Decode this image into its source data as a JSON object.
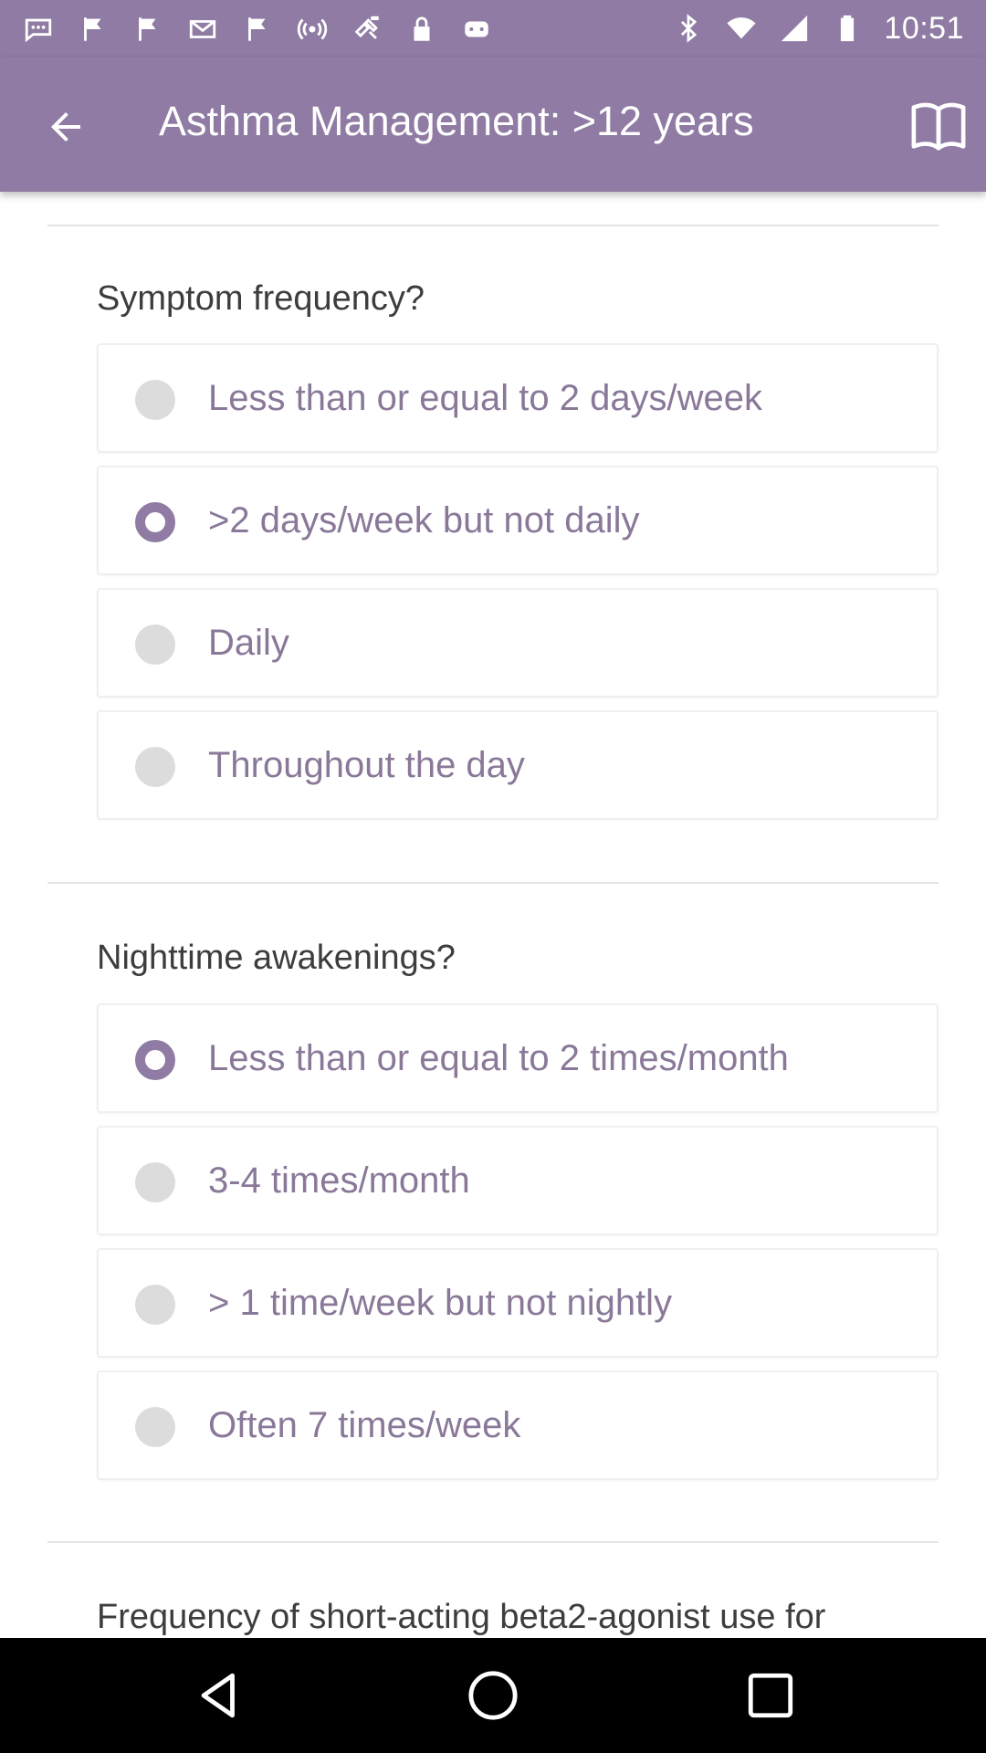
{
  "status_bar": {
    "time": "10:51",
    "left_icons": [
      "message-icon",
      "flag-icon",
      "flag-icon",
      "mail-icon",
      "flag-icon",
      "hotspot-icon",
      "fake-gps-icon",
      "lock-icon",
      "game-controller-icon"
    ],
    "right_icons": [
      "bluetooth-icon",
      "wifi-icon",
      "signal-icon",
      "battery-icon"
    ]
  },
  "app_bar": {
    "title": "Asthma Management: >12 years",
    "back_icon": "arrow-back-icon",
    "reference_icon": "book-icon",
    "color": "#8f7ba3"
  },
  "main": {
    "sections": [
      {
        "question": "Symptom frequency?",
        "options": [
          {
            "label": "Less than or equal to 2 days/week",
            "selected": false
          },
          {
            "label": ">2 days/week but not daily",
            "selected": true
          },
          {
            "label": "Daily",
            "selected": false
          },
          {
            "label": "Throughout the day",
            "selected": false
          }
        ]
      },
      {
        "question": "Nighttime awakenings?",
        "options": [
          {
            "label": "Less than or equal to 2 times/month",
            "selected": true
          },
          {
            "label": "3-4 times/month",
            "selected": false
          },
          {
            "label": "> 1 time/week but not nightly",
            "selected": false
          },
          {
            "label": "Often 7 times/week",
            "selected": false
          }
        ]
      },
      {
        "question": "Frequency of short-acting beta2-agonist use for"
      }
    ]
  },
  "nav_bar": {
    "back_icon": "nav-back-icon",
    "home_icon": "nav-home-icon",
    "recents_icon": "nav-recents-icon"
  },
  "colors": {
    "accent": "#8f7ba3",
    "option_text": "#8a7899",
    "question_text": "#3d3d3d"
  }
}
